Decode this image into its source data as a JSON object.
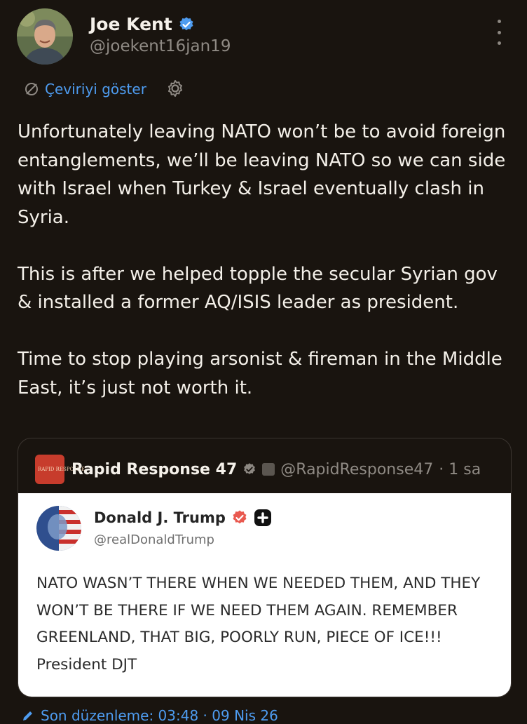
{
  "author": {
    "name": "Joe Kent",
    "handle": "@joekent16jan19",
    "verified_color": "#4e9cf0"
  },
  "translate": {
    "label": "Çeviriyi göster",
    "icon": "translate-icon"
  },
  "tweet": {
    "paragraphs": [
      "Unfortunately leaving NATO won’t be to avoid foreign entanglements, we’ll be leaving NATO so we can side with Israel when Turkey & Israel eventually clash in Syria.",
      "This is after we helped topple the secular Syrian gov & installed a former AQ/ISIS leader as president.",
      "Time to stop playing arsonist & fireman in the Middle East, it’s just not worth it."
    ]
  },
  "quote": {
    "logo_text": "RAPID RESPONSE",
    "name": "Rapid Response 47",
    "handle": "@RapidResponse47",
    "time": "· 1 sa",
    "inner": {
      "name": "Donald J. Trump",
      "handle": "@realDonaldTrump",
      "text": "NATO WASN’T THERE WHEN WE NEEDED THEM, AND THEY WON’T BE THERE IF WE NEED THEM AGAIN. REMEMBER GREENLAND, THAT BIG, POORLY RUN, PIECE OF ICE!!! President DJT"
    }
  },
  "edit": {
    "label": "Son düzenleme: 03:48 · 09 Nis 26"
  }
}
